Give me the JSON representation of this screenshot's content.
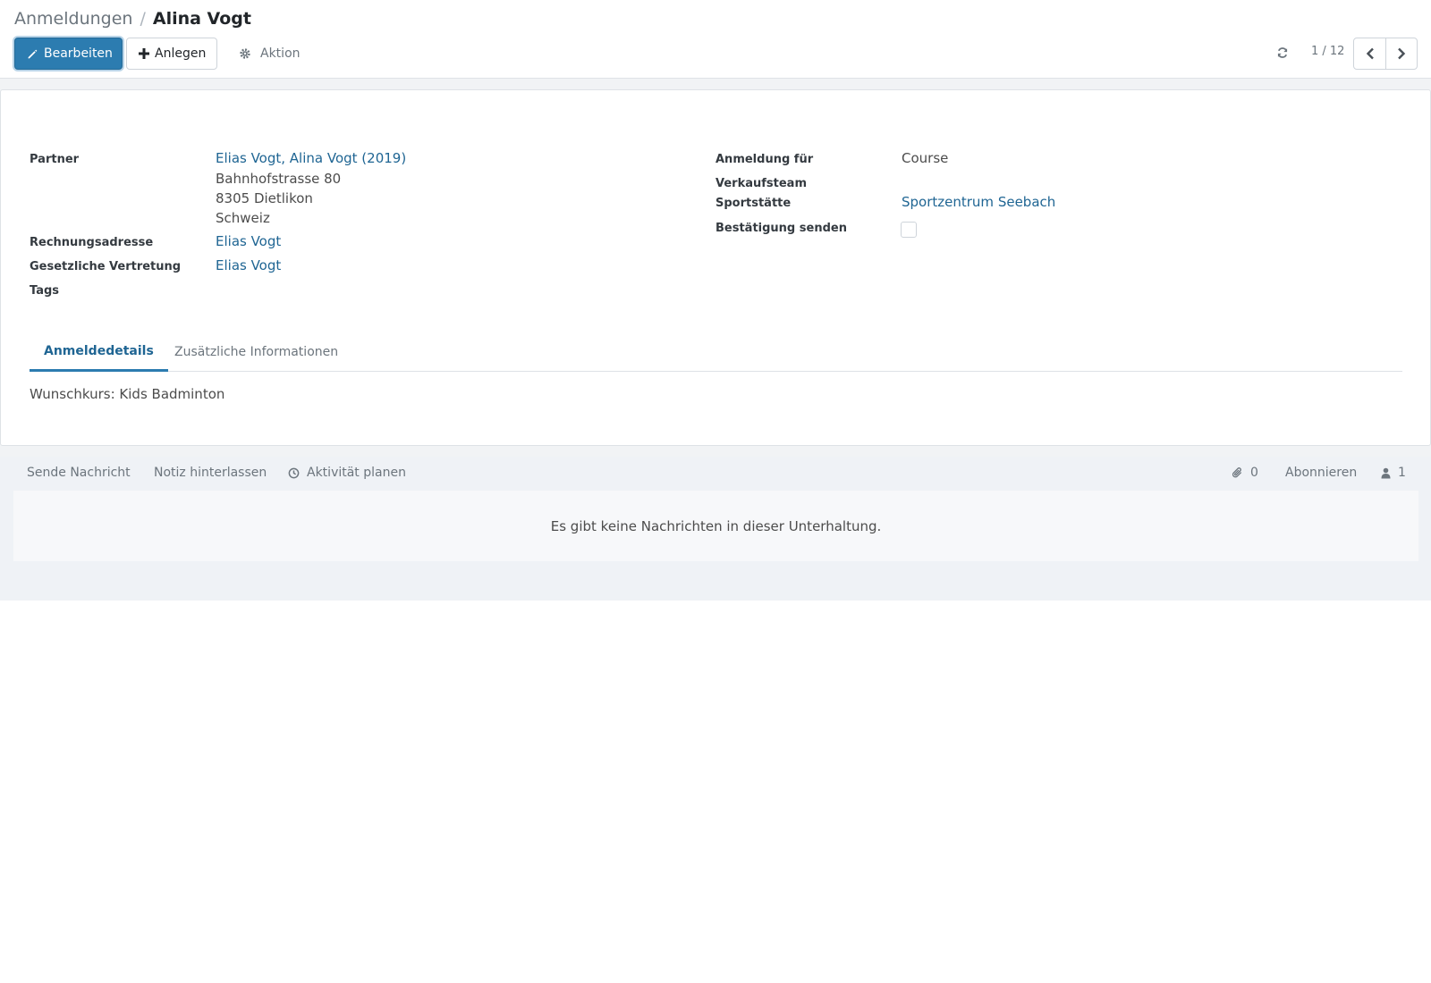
{
  "breadcrumb": {
    "parent": "Anmeldungen",
    "separator": "/",
    "current": "Alina Vogt"
  },
  "toolbar": {
    "edit_label": "Bearbeiten",
    "create_label": "Anlegen",
    "action_label": "Aktion"
  },
  "pager": {
    "value": "1 / 12"
  },
  "form": {
    "partner": {
      "label": "Partner",
      "name": "Elias Vogt, Alina Vogt (2019)",
      "street": "Bahnhofstrasse 80",
      "city": "8305 Dietlikon",
      "country": "Schweiz"
    },
    "billing_address": {
      "label": "Rechnungsadresse",
      "value": "Elias Vogt"
    },
    "legal_rep": {
      "label": "Gesetzliche Vertretung",
      "value": "Elias Vogt"
    },
    "tags": {
      "label": "Tags"
    },
    "registration_for": {
      "label": "Anmeldung für",
      "value": "Course"
    },
    "sales_team": {
      "label": "Verkaufsteam"
    },
    "venue": {
      "label": "Sportstätte",
      "value": "Sportzentrum Seebach"
    },
    "send_confirmation": {
      "label": "Bestätigung senden",
      "checked": false
    }
  },
  "tabs": [
    {
      "label": "Anmeldedetails",
      "active": true
    },
    {
      "label": "Zusätzliche Informationen",
      "active": false
    }
  ],
  "tab_content": "Wunschkurs: Kids Badminton",
  "chatter": {
    "send_message": "Sende Nachricht",
    "log_note": "Notiz hinterlassen",
    "schedule_activity": "Aktivität planen",
    "attachments_count": "0",
    "follow": "Abonnieren",
    "followers_count": "1",
    "empty_text": "Es gibt keine Nachrichten in dieser Unterhaltung."
  },
  "colors": {
    "primary": "#2c7cb0",
    "link": "#1f6593"
  },
  "icons": {
    "edit": "pencil-icon",
    "create": "plus-icon",
    "action": "gear-icon",
    "refresh": "refresh-icon",
    "prev": "chevron-left-icon",
    "next": "chevron-right-icon",
    "activity": "clock-icon",
    "attachment": "paperclip-icon",
    "followers": "user-icon"
  }
}
